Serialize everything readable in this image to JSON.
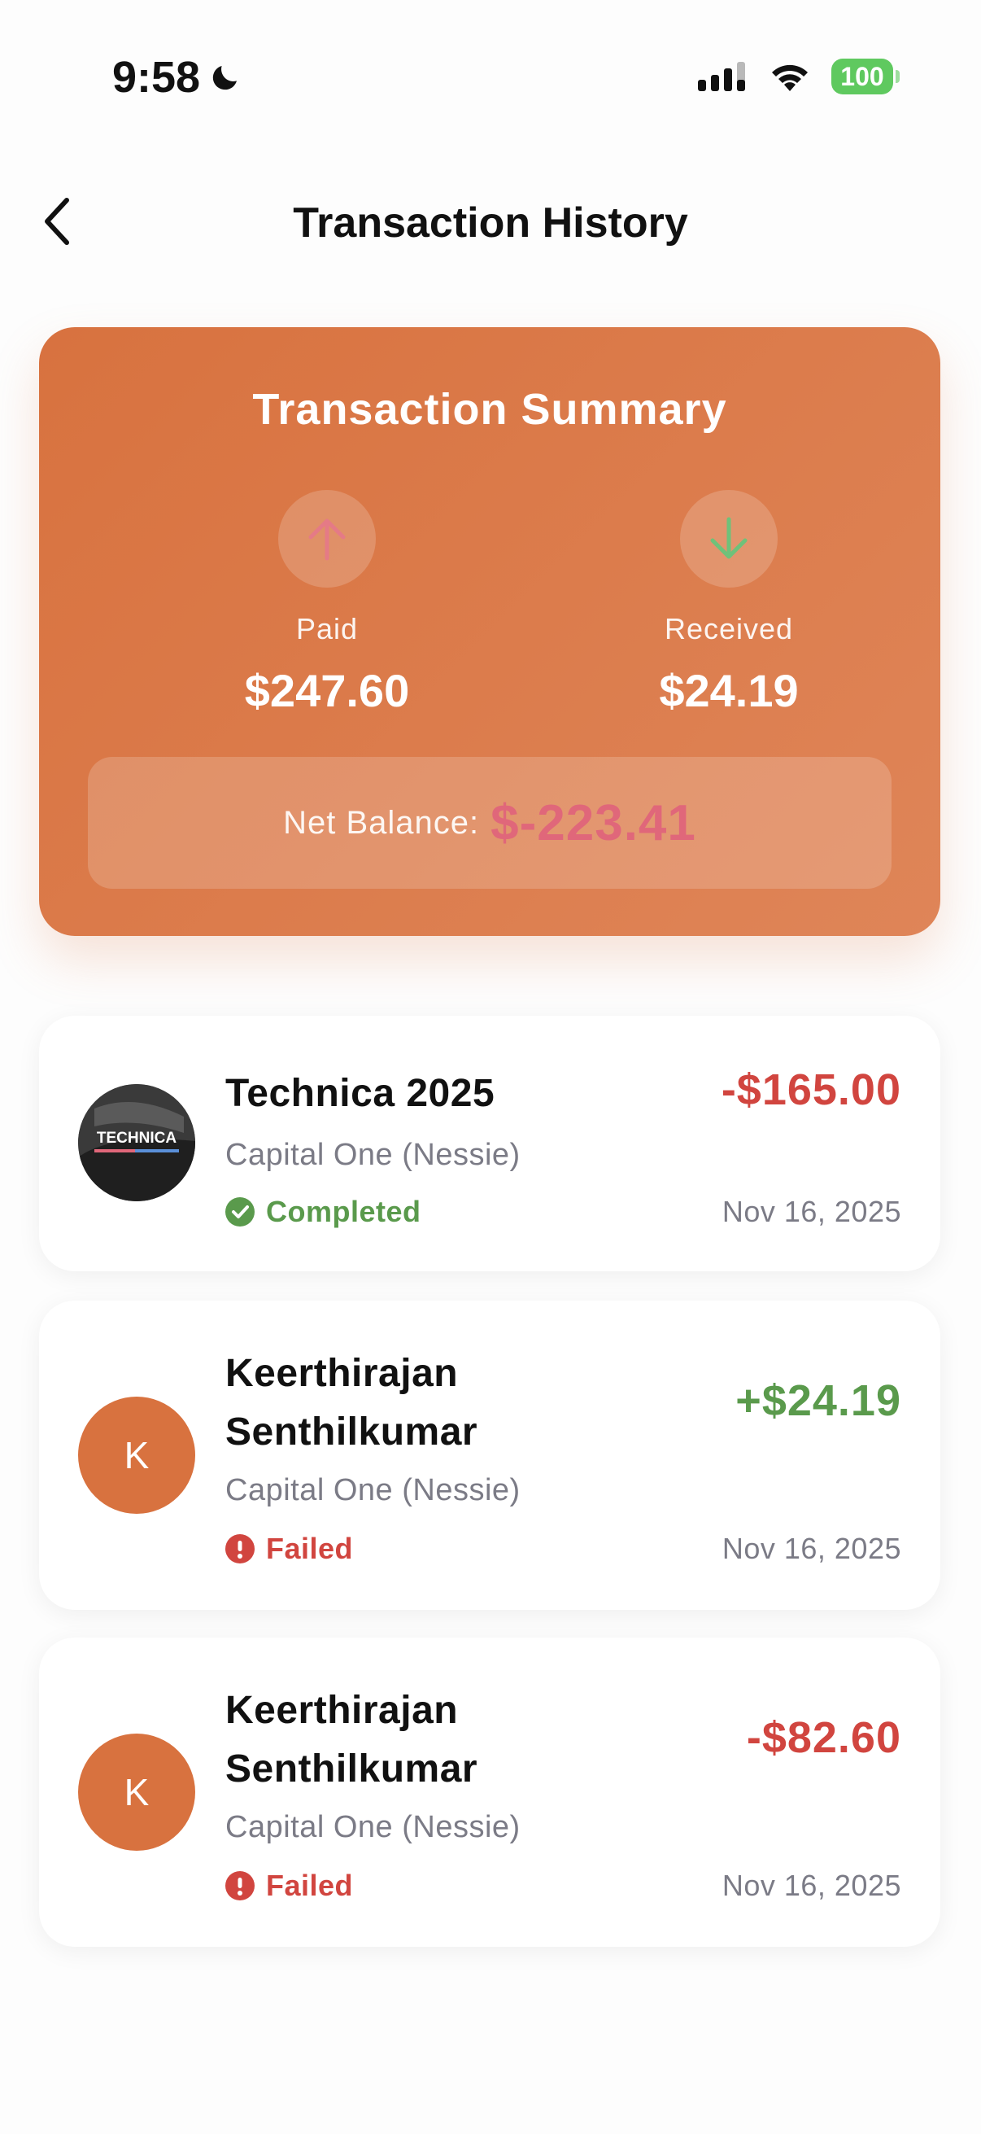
{
  "status_bar": {
    "time": "9:58",
    "battery": "100"
  },
  "nav": {
    "title": "Transaction History"
  },
  "summary": {
    "title": "Transaction Summary",
    "paid_label": "Paid",
    "paid_value": "$247.60",
    "received_label": "Received",
    "received_value": "$24.19",
    "net_label": "Net Balance:",
    "net_value": "$-223.41"
  },
  "transactions": [
    {
      "name": "Technica 2025",
      "bank": "Capital One (Nessie)",
      "status": "Completed",
      "amount": "-$165.00",
      "date": "Nov 16, 2025",
      "logo_text": "TECHNICA"
    },
    {
      "name_line1": "Keerthirajan",
      "name_line2": "Senthilkumar",
      "initial": "K",
      "bank": "Capital One (Nessie)",
      "status": "Failed",
      "amount": "+$24.19",
      "date": "Nov 16, 2025"
    },
    {
      "name_line1": "Keerthirajan",
      "name_line2": "Senthilkumar",
      "initial": "K",
      "bank": "Capital One (Nessie)",
      "status": "Failed",
      "amount": "-$82.60",
      "date": "Nov 16, 2025"
    }
  ],
  "colors": {
    "accent": "#d8723f",
    "negative": "#d1453f",
    "positive": "#5a9a4c",
    "muted": "#7b7b86"
  }
}
